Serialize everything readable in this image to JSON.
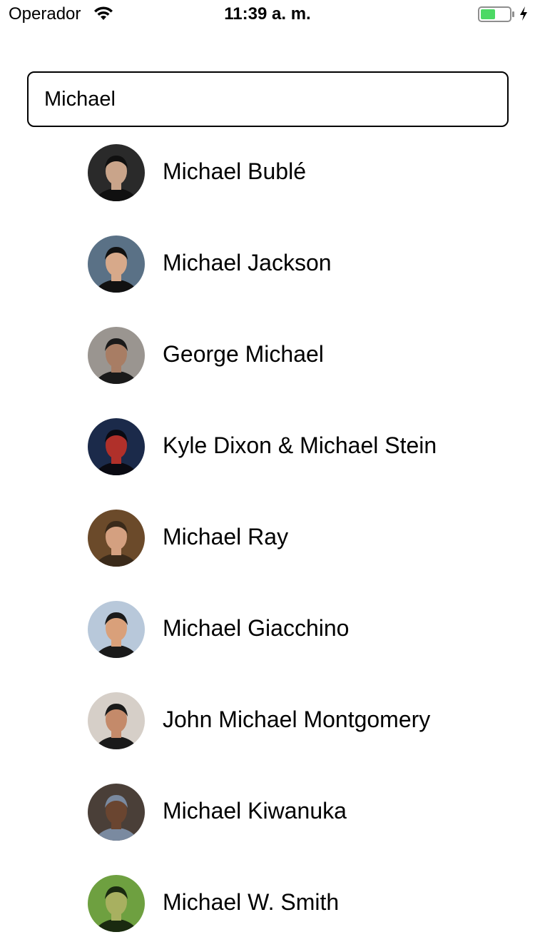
{
  "status_bar": {
    "carrier": "Operador",
    "time": "11:39 a. m.",
    "battery_color": "#4cd964"
  },
  "search": {
    "value": "Michael"
  },
  "results": [
    {
      "name": "Michael Bublé",
      "avatar_colors": [
        "#2a2a2a",
        "#c9a48a",
        "#101010"
      ]
    },
    {
      "name": "Michael Jackson",
      "avatar_colors": [
        "#5a7186",
        "#d7a98a",
        "#111111"
      ]
    },
    {
      "name": "George Michael",
      "avatar_colors": [
        "#9a9590",
        "#a87d64",
        "#1a1a1a"
      ]
    },
    {
      "name": "Kyle Dixon & Michael Stein",
      "avatar_colors": [
        "#1b2a4a",
        "#b0302a",
        "#0a0a12"
      ]
    },
    {
      "name": "Michael Ray",
      "avatar_colors": [
        "#6b4a2a",
        "#d4a080",
        "#3a2a1a"
      ]
    },
    {
      "name": "Michael Giacchino",
      "avatar_colors": [
        "#b8c8da",
        "#d9a07a",
        "#1a1a1a"
      ]
    },
    {
      "name": "John Michael Montgomery",
      "avatar_colors": [
        "#d6cfc8",
        "#c48a6a",
        "#1a1a1a"
      ]
    },
    {
      "name": "Michael Kiwanuka",
      "avatar_colors": [
        "#4a3f38",
        "#6a4530",
        "#7a8aa0"
      ]
    },
    {
      "name": "Michael W. Smith",
      "avatar_colors": [
        "#6ea040",
        "#a8b060",
        "#1a2a10"
      ]
    }
  ]
}
